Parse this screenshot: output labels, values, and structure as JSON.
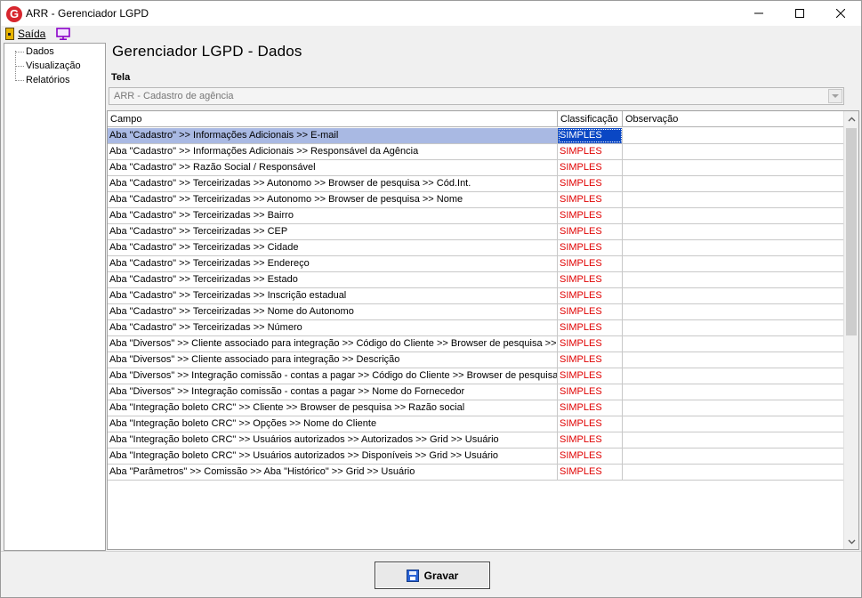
{
  "window": {
    "title": "ARR - Gerenciador LGPD",
    "icon_letter": "G",
    "controls": [
      "minimize",
      "maximize",
      "close"
    ]
  },
  "menu": {
    "exit_label": "Saída"
  },
  "sidebar": {
    "items": [
      {
        "label": "Dados"
      },
      {
        "label": "Visualização"
      },
      {
        "label": "Relatórios"
      }
    ]
  },
  "main": {
    "title": "Gerenciador LGPD - Dados",
    "tela_label": "Tela",
    "tela_value": "ARR - Cadastro de agência"
  },
  "grid": {
    "columns": [
      "Campo",
      "Classificação",
      "Observação"
    ],
    "selected_row": 0,
    "rows": [
      {
        "campo": "Aba \"Cadastro\" >> Informações Adicionais >> E-mail",
        "classificacao": "SIMPLES",
        "observacao": ""
      },
      {
        "campo": "Aba \"Cadastro\" >> Informações Adicionais >> Responsável da Agência",
        "classificacao": "SIMPLES",
        "observacao": ""
      },
      {
        "campo": "Aba \"Cadastro\" >> Razão Social / Responsável",
        "classificacao": "SIMPLES",
        "observacao": ""
      },
      {
        "campo": "Aba \"Cadastro\" >> Terceirizadas >> Autonomo >> Browser de pesquisa >> Cód.Int.",
        "classificacao": "SIMPLES",
        "observacao": ""
      },
      {
        "campo": "Aba \"Cadastro\" >> Terceirizadas >> Autonomo >> Browser de pesquisa >> Nome",
        "classificacao": "SIMPLES",
        "observacao": ""
      },
      {
        "campo": "Aba \"Cadastro\" >> Terceirizadas >> Bairro",
        "classificacao": "SIMPLES",
        "observacao": ""
      },
      {
        "campo": "Aba \"Cadastro\" >> Terceirizadas >> CEP",
        "classificacao": "SIMPLES",
        "observacao": ""
      },
      {
        "campo": "Aba \"Cadastro\" >> Terceirizadas >> Cidade",
        "classificacao": "SIMPLES",
        "observacao": ""
      },
      {
        "campo": "Aba \"Cadastro\" >> Terceirizadas >> Endereço",
        "classificacao": "SIMPLES",
        "observacao": ""
      },
      {
        "campo": "Aba \"Cadastro\" >> Terceirizadas >> Estado",
        "classificacao": "SIMPLES",
        "observacao": ""
      },
      {
        "campo": "Aba \"Cadastro\" >> Terceirizadas >> Inscrição estadual",
        "classificacao": "SIMPLES",
        "observacao": ""
      },
      {
        "campo": "Aba \"Cadastro\" >> Terceirizadas >> Nome do  Autonomo",
        "classificacao": "SIMPLES",
        "observacao": ""
      },
      {
        "campo": "Aba \"Cadastro\" >> Terceirizadas >> Número",
        "classificacao": "SIMPLES",
        "observacao": ""
      },
      {
        "campo": "Aba \"Diversos\" >> Cliente associado para integração >> Código do Cliente >> Browser de pesquisa >> ...",
        "classificacao": "SIMPLES",
        "observacao": ""
      },
      {
        "campo": "Aba \"Diversos\" >> Cliente associado para integração >> Descrição",
        "classificacao": "SIMPLES",
        "observacao": ""
      },
      {
        "campo": "Aba \"Diversos\" >> Integração comissão - contas a pagar  >> Código do Cliente >> Browser de pesquisa ...",
        "classificacao": "SIMPLES",
        "observacao": ""
      },
      {
        "campo": "Aba \"Diversos\" >> Integração comissão - contas a pagar >> Nome do Fornecedor",
        "classificacao": "SIMPLES",
        "observacao": ""
      },
      {
        "campo": "Aba \"Integração boleto CRC\" >> Cliente >> Browser de pesquisa >> Razão social",
        "classificacao": "SIMPLES",
        "observacao": ""
      },
      {
        "campo": "Aba \"Integração boleto CRC\" >> Opções >> Nome do Cliente",
        "classificacao": "SIMPLES",
        "observacao": ""
      },
      {
        "campo": "Aba \"Integração boleto CRC\" >> Usuários autorizados >> Autorizados >> Grid >> Usuário",
        "classificacao": "SIMPLES",
        "observacao": ""
      },
      {
        "campo": "Aba \"Integração boleto CRC\" >> Usuários autorizados >> Disponíveis >> Grid >> Usuário",
        "classificacao": "SIMPLES",
        "observacao": ""
      },
      {
        "campo": "Aba \"Parâmetros\" >> Comissão >> Aba \"Histórico\" >> Grid >> Usuário",
        "classificacao": "SIMPLES",
        "observacao": ""
      }
    ]
  },
  "footer": {
    "save_label": "Gravar"
  },
  "colors": {
    "classification_text": "#e00000",
    "selection_row": "#a9b9e3",
    "selection_cell": "#0a47c4",
    "app_icon": "#d7262e"
  }
}
